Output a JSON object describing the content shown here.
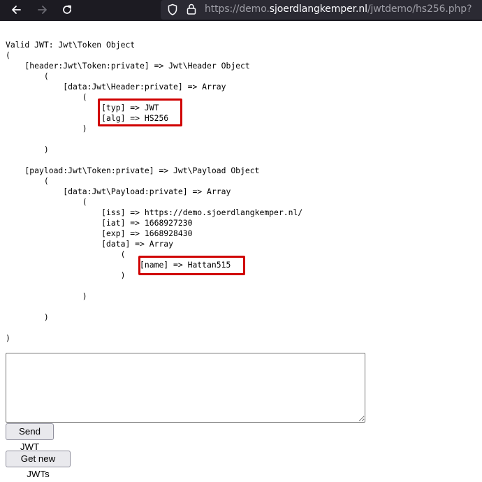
{
  "browser": {
    "url_prefix": "https://demo.",
    "url_host": "sjoerdlangkemper.nl",
    "url_path": "/jwtdemo/hs256.php?"
  },
  "dump": {
    "lines": [
      "Valid JWT: Jwt\\Token Object",
      "(",
      "    [header:Jwt\\Token:private] => Jwt\\Header Object",
      "        (",
      "            [data:Jwt\\Header:private] => Array",
      "                (",
      "                    [typ] => JWT",
      "                    [alg] => HS256",
      "                )",
      "",
      "        )",
      "",
      "    [payload:Jwt\\Token:private] => Jwt\\Payload Object",
      "        (",
      "            [data:Jwt\\Payload:private] => Array",
      "                (",
      "                    [iss] => https://demo.sjoerdlangkemper.nl/",
      "                    [iat] => 1668927230",
      "                    [exp] => 1668928430",
      "                    [data] => Array",
      "                        (",
      "                            [name] => Hattan515",
      "                        )",
      "",
      "                )",
      "",
      "        )",
      "",
      ")"
    ]
  },
  "form": {
    "jwt_value": "",
    "send_label": "Send JWT",
    "new_label": "Get new JWTs"
  }
}
